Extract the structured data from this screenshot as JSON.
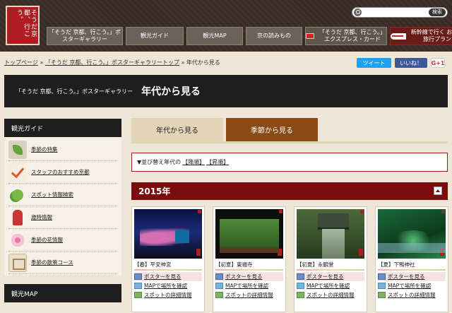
{
  "header": {
    "logo_text": "そうだ京都、行こう。",
    "search_button": "検索",
    "nav": [
      {
        "label": "「そうだ 京都、行こう。」ポスターギャラリー"
      },
      {
        "label": "観光ガイド"
      },
      {
        "label": "観光MAP"
      },
      {
        "label": "京の読みもの"
      },
      {
        "label": "「そうだ 京都、行こう。」エクスプレス・カード"
      },
      {
        "label": "新幹線で行く お得な旅行プラン"
      }
    ]
  },
  "breadcrumb": {
    "items": [
      "トップページ",
      "「そうだ 京都、行こう。」ポスターギャラリートップ",
      "年代から見る"
    ],
    "separator": "»"
  },
  "social": {
    "tweet": "ツイート",
    "like": "いいね！",
    "gplus": "G+1"
  },
  "title": {
    "sub": "「そうだ 京都、行こう。」ポスターギャラリー",
    "main": "年代から見る"
  },
  "sidebar": {
    "guide_head": "観光ガイド",
    "items": [
      {
        "label": "季節の特集",
        "icon": "leaf-icon"
      },
      {
        "label": "スタッフのおすすめ京都",
        "icon": "check-icon"
      },
      {
        "label": "スポット情報検索",
        "icon": "spot-icon"
      },
      {
        "label": "歳時情報",
        "icon": "calendar-icon"
      },
      {
        "label": "季節の花情報",
        "icon": "flower-icon"
      },
      {
        "label": "季節の散策コース",
        "icon": "course-icon"
      }
    ],
    "map_head": "観光MAP"
  },
  "tabs": [
    {
      "label": "年代から見る",
      "active": true
    },
    {
      "label": "季節から見る",
      "active": false
    }
  ],
  "sort": {
    "prefix": "▼並び替え年代の",
    "desc": "【降順】",
    "asc": "【昇順】"
  },
  "year": "2015年",
  "cards": [
    {
      "caption": "【春】平安神宮",
      "poster": "ポスターを見る",
      "map": "MAPで場所を確認",
      "detail": "スポットの詳細情報"
    },
    {
      "caption": "【初夏】東福寺",
      "poster": "ポスターを見る",
      "map": "MAPで場所を確認",
      "detail": "スポットの詳細情報"
    },
    {
      "caption": "【初夏】永観堂",
      "poster": "ポスターを見る",
      "map": "MAPで場所を確認",
      "detail": "スポットの詳細情報"
    },
    {
      "caption": "【夏】下鴨神社",
      "poster": "ポスターを見る",
      "map": "MAPで場所を確認",
      "detail": "スポットの詳細情報"
    }
  ]
}
